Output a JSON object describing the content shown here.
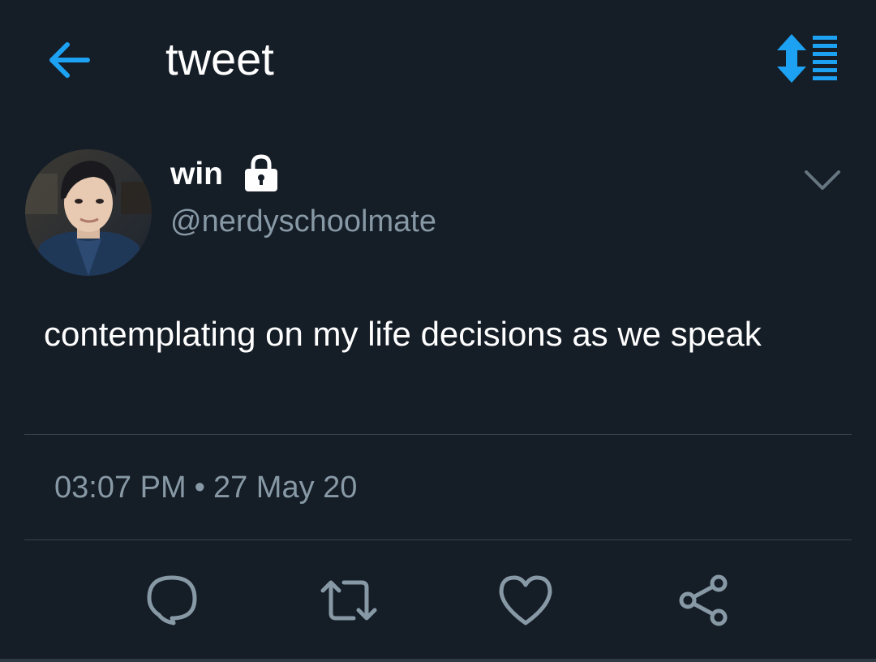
{
  "header": {
    "title": "tweet",
    "back_icon": "arrow-left-icon",
    "sort_icon": "sort-arrows-list-icon"
  },
  "tweet": {
    "author": {
      "display_name": "win",
      "handle": "@nerdyschoolmate",
      "protected_icon": "lock-icon",
      "avatar_icon": "profile-photo"
    },
    "text": "contemplating on my life decisions as we speak",
    "time": "03:07 PM",
    "separator": "•",
    "date": "27 May 20",
    "menu_icon": "chevron-down-icon"
  },
  "actions": [
    {
      "name": "reply",
      "icon": "reply-bubble-icon"
    },
    {
      "name": "retweet",
      "icon": "retweet-icon"
    },
    {
      "name": "like",
      "icon": "heart-icon"
    },
    {
      "name": "share",
      "icon": "share-icon"
    }
  ],
  "colors": {
    "background": "#151d27",
    "accent": "#1da1f2",
    "text_primary": "#ffffff",
    "text_secondary": "#8899a6",
    "divider": "#38444d"
  }
}
